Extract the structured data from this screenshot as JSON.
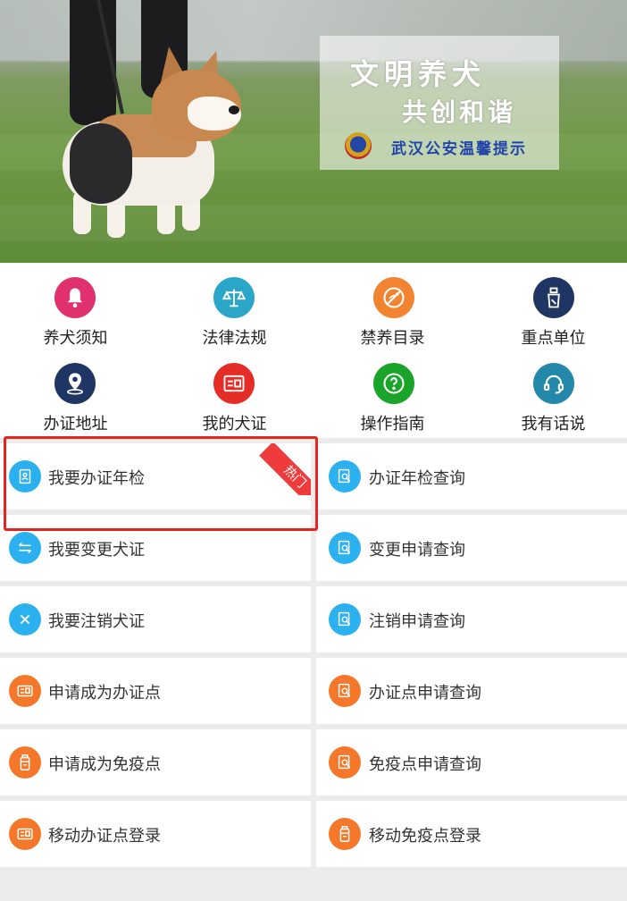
{
  "banner": {
    "slogan_line1": "文明养犬",
    "slogan_line2": "共创和谐",
    "slogan_line3": "武汉公安温馨提示",
    "overlay_color": "#ffffff"
  },
  "icon_grid": [
    {
      "label": "养犬须知",
      "icon": "bell-icon",
      "color": "#e0306d"
    },
    {
      "label": "法律法规",
      "icon": "scales-icon",
      "color": "#2aa6c9"
    },
    {
      "label": "禁养目录",
      "icon": "no-dog-icon",
      "color": "#f28330"
    },
    {
      "label": "重点单位",
      "icon": "building-icon",
      "color": "#1f3563"
    },
    {
      "label": "办证地址",
      "icon": "location-pin-icon",
      "color": "#1f3563"
    },
    {
      "label": "我的犬证",
      "icon": "id-card-icon",
      "color": "#e32d26"
    },
    {
      "label": "操作指南",
      "icon": "question-icon",
      "color": "#1aa42a"
    },
    {
      "label": "我有话说",
      "icon": "headset-icon",
      "color": "#2488ab"
    }
  ],
  "menu": {
    "hot_badge": "热门",
    "rows": [
      [
        {
          "label": "我要办证年检",
          "icon": "certificate-icon",
          "color": "blue"
        },
        {
          "label": "办证年检查询",
          "icon": "search-doc-icon",
          "color": "blue"
        }
      ],
      [
        {
          "label": "我要变更犬证",
          "icon": "swap-icon",
          "color": "blue"
        },
        {
          "label": "变更申请查询",
          "icon": "search-doc-icon",
          "color": "blue"
        }
      ],
      [
        {
          "label": "我要注销犬证",
          "icon": "close-icon",
          "color": "blue"
        },
        {
          "label": "注销申请查询",
          "icon": "search-doc-icon",
          "color": "blue"
        }
      ],
      [
        {
          "label": "申请成为办证点",
          "icon": "id-card-icon",
          "color": "orange"
        },
        {
          "label": "办证点申请查询",
          "icon": "search-doc-icon",
          "color": "orange"
        }
      ],
      [
        {
          "label": "申请成为免疫点",
          "icon": "vaccine-bottle-icon",
          "color": "orange"
        },
        {
          "label": "免疫点申请查询",
          "icon": "search-doc-icon",
          "color": "orange"
        }
      ],
      [
        {
          "label": "移动办证点登录",
          "icon": "id-card-icon",
          "color": "orange"
        },
        {
          "label": "移动免疫点登录",
          "icon": "vaccine-bottle-icon",
          "color": "orange"
        }
      ]
    ]
  },
  "colors": {
    "accent_blue": "#2bb1ef",
    "accent_orange": "#f5782a",
    "highlight_red": "#e3241f"
  }
}
